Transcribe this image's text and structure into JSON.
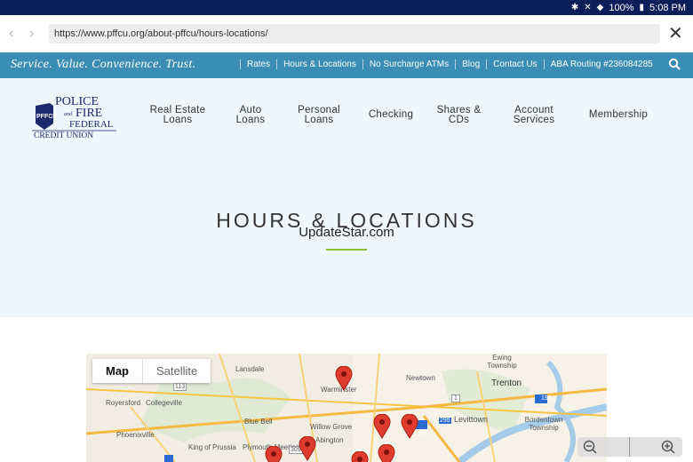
{
  "status": {
    "battery": "100%",
    "time": "5:08 PM"
  },
  "browser": {
    "url": "https://www.pffcu.org/about-pffcu/hours-locations/"
  },
  "topbar": {
    "tagline": "Service. Value. Convenience. Trust.",
    "links": [
      "Rates",
      "Hours & Locations",
      "No Surcharge ATMs",
      "Blog",
      "Contact Us",
      "ABA Routing #236084285"
    ]
  },
  "logo": {
    "line1": "POLICE",
    "line2": "FIRE",
    "line3": "FEDERAL",
    "line4": "CREDIT UNION",
    "badge": "PFFCU",
    "and": "and"
  },
  "nav": {
    "items": [
      {
        "l1": "Real Estate",
        "l2": "Loans"
      },
      {
        "l1": "Auto",
        "l2": "Loans"
      },
      {
        "l1": "Personal",
        "l2": "Loans"
      },
      {
        "l1": "Checking",
        "l2": ""
      },
      {
        "l1": "Shares &",
        "l2": "CDs"
      },
      {
        "l1": "Account",
        "l2": "Services"
      },
      {
        "l1": "Membership",
        "l2": ""
      }
    ]
  },
  "hero": {
    "title": "HOURS & LOCATIONS",
    "watermark": "UpdateStar.com"
  },
  "map": {
    "tabs": [
      "Map",
      "Satellite"
    ],
    "places": [
      "Lansdale",
      "Royersford",
      "Collegeville",
      "Warminster",
      "Newtown",
      "Trenton",
      "Ewing Township",
      "Phoenixville",
      "Blue Bell",
      "Willow Grove",
      "Levittown",
      "Bordentown Township",
      "King of Prussia",
      "Plymouth Meeting",
      "Abington"
    ],
    "roads": [
      "113",
      "309",
      "1",
      "195",
      "276",
      "295"
    ]
  }
}
